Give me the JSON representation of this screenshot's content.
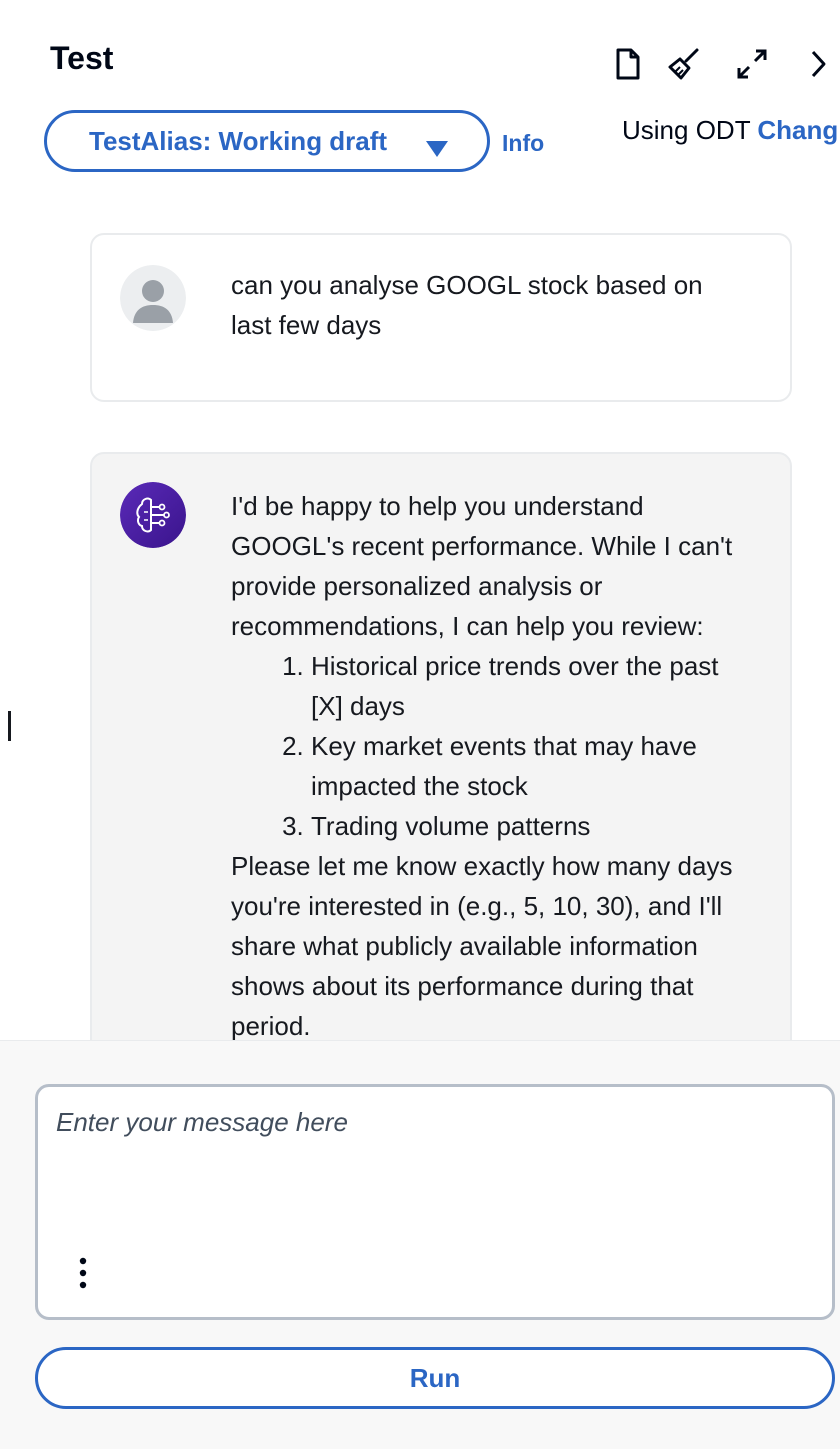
{
  "header": {
    "title": "Test",
    "icons": [
      "document-icon",
      "broom-icon",
      "expand-icon",
      "chevron-right-icon"
    ]
  },
  "alias": {
    "selected": "TestAlias: Working draft",
    "info_label": "Info"
  },
  "odt": {
    "text": "Using ODT",
    "change_label": "Chang"
  },
  "conversation": {
    "user_message": "can you analyse GOOGL stock based on last few days",
    "bot_intro": "I'd be happy to help you understand GOOGL's recent performance. While I can't provide personalized analysis or recommendations, I can help you review:",
    "bot_list": [
      "Historical price trends over the past [X] days",
      "Key market events that may have impacted the stock",
      "Trading volume patterns"
    ],
    "bot_outro": "Please let me know exactly how many days you're interested in (e.g., 5, 10, 30), and I'll share what publicly available information shows about its performance during that period."
  },
  "composer": {
    "placeholder": "Enter your message here",
    "value": ""
  },
  "run_label": "Run",
  "colors": {
    "accent": "#2b66c4",
    "bot_bubble": "#f4f4f4",
    "bot_avatar": "#4b1fa3"
  }
}
